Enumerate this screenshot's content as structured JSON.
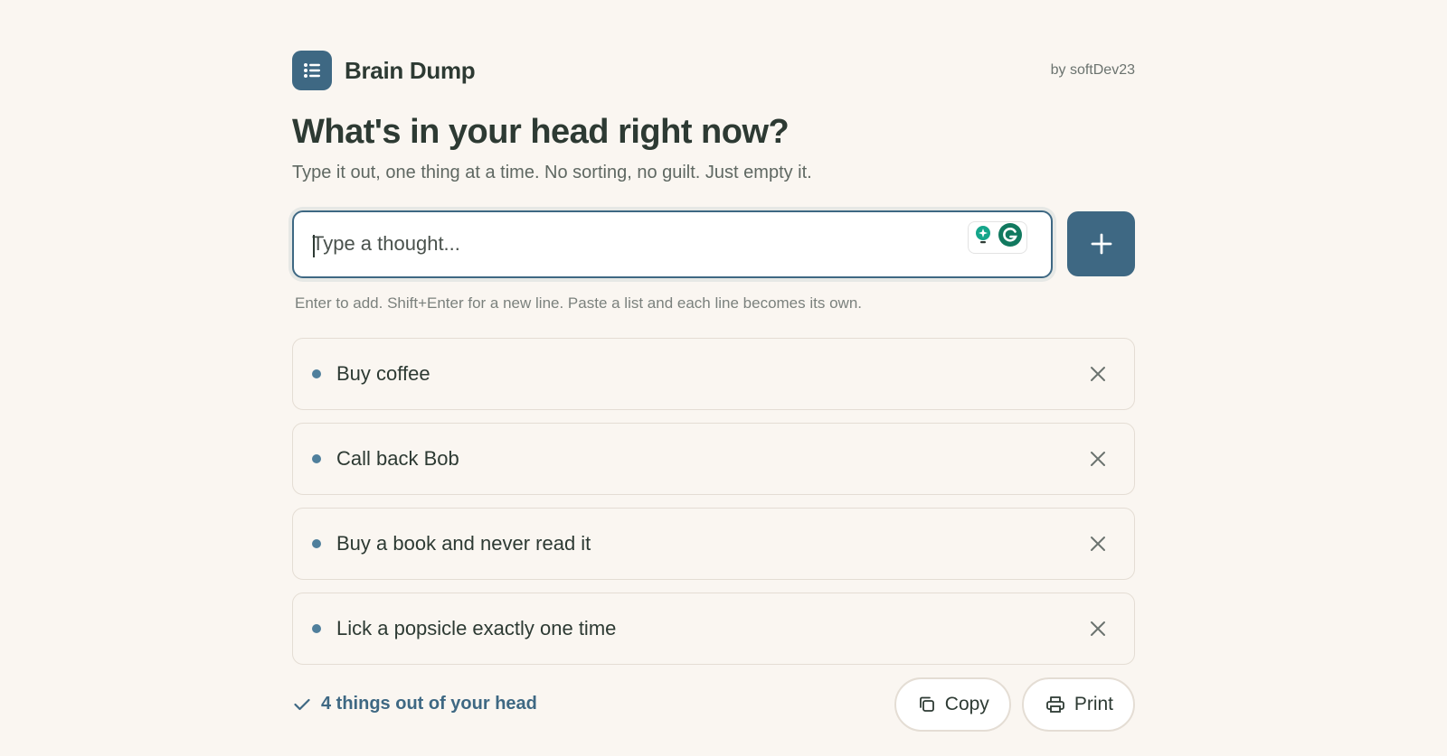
{
  "header": {
    "brand_name": "Brain Dump",
    "byline": "by softDev23",
    "logo_icon": "list-icon"
  },
  "main": {
    "title": "What's in your head right now?",
    "subtitle": "Type it out, one thing at a time. No sorting, no guilt. Just empty it."
  },
  "input": {
    "value": "",
    "placeholder": "Type a thought...",
    "hint": "Enter to add. Shift+Enter for a new line. Paste a list and each line becomes its own."
  },
  "items": [
    {
      "text": "Buy coffee"
    },
    {
      "text": "Call back Bob"
    },
    {
      "text": "Buy a book and never read it"
    },
    {
      "text": "Lick a popsicle exactly one time"
    }
  ],
  "footer": {
    "count_label": "4 things out of your head",
    "copy_label": "Copy",
    "print_label": "Print"
  },
  "colors": {
    "accent": "#3e6883",
    "background": "#faf6f1",
    "text": "#2d3a33",
    "bullet": "#4f7f9c"
  }
}
